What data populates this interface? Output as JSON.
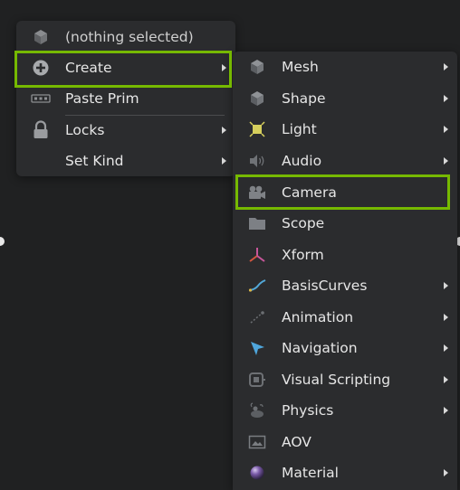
{
  "main_menu": {
    "items": [
      {
        "label": "(nothing selected)",
        "icon": "cube-icon",
        "has_submenu": false
      },
      {
        "label": "Create",
        "icon": "plus-circle-icon",
        "has_submenu": true
      },
      {
        "label": "Paste Prim",
        "icon": "paste-icon",
        "has_submenu": false
      },
      {
        "label": "Locks",
        "icon": "lock-icon",
        "has_submenu": true
      },
      {
        "label": "Set Kind",
        "icon": "",
        "has_submenu": true
      }
    ]
  },
  "create_submenu": {
    "items": [
      {
        "label": "Mesh",
        "icon": "mesh-cube-icon",
        "has_submenu": true
      },
      {
        "label": "Shape",
        "icon": "shape-cube-icon",
        "has_submenu": true
      },
      {
        "label": "Light",
        "icon": "light-icon",
        "has_submenu": true
      },
      {
        "label": "Audio",
        "icon": "speaker-icon",
        "has_submenu": true
      },
      {
        "label": "Camera",
        "icon": "camera-icon",
        "has_submenu": false
      },
      {
        "label": "Scope",
        "icon": "folder-icon",
        "has_submenu": false
      },
      {
        "label": "Xform",
        "icon": "xform-axes-icon",
        "has_submenu": false
      },
      {
        "label": "BasisCurves",
        "icon": "curve-icon",
        "has_submenu": true
      },
      {
        "label": "Animation",
        "icon": "animation-icon",
        "has_submenu": true
      },
      {
        "label": "Navigation",
        "icon": "navigation-arrow-icon",
        "has_submenu": true
      },
      {
        "label": "Visual Scripting",
        "icon": "visual-scripting-icon",
        "has_submenu": true
      },
      {
        "label": "Physics",
        "icon": "physics-icon",
        "has_submenu": true
      },
      {
        "label": "AOV",
        "icon": "aov-image-icon",
        "has_submenu": false
      },
      {
        "label": "Material",
        "icon": "material-sphere-icon",
        "has_submenu": true
      }
    ]
  },
  "colors": {
    "highlight": "#76b900",
    "menu_bg": "#2b2c2e",
    "background": "#202122"
  }
}
